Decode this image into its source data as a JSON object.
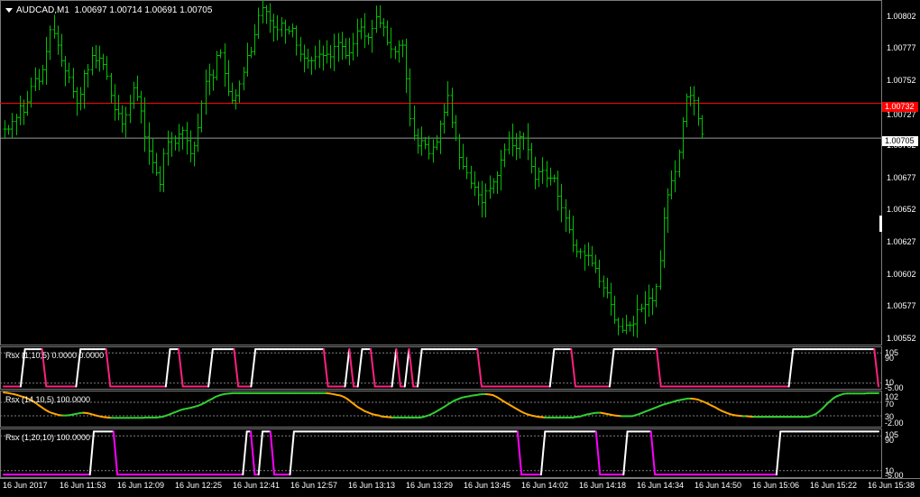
{
  "header": {
    "symbol_label": "AUDCAD,M1",
    "ohlc_label": "1.00697 1.00714 1.00691 1.00705"
  },
  "price_scale": {
    "ticks": [
      "1.00802",
      "1.00777",
      "1.00752",
      "1.00727",
      "1.00702",
      "1.00677",
      "1.00652",
      "1.00627",
      "1.00602",
      "1.00577",
      "1.00552"
    ],
    "red_line_label": "1.00732",
    "current_price_label": "1.00705"
  },
  "indicators": [
    {
      "title": "Rsx (1,10,5) 0.0000 0.0000",
      "axis_labels": [
        "105",
        "90",
        "10",
        "-5.00"
      ]
    },
    {
      "title": "Rsx (14,10,5) 100.0000",
      "axis_labels": [
        "102",
        "70",
        "30",
        "-2.00"
      ]
    },
    {
      "title": "Rsx (1,20,10) 100.0000",
      "axis_labels": [
        "105",
        "90",
        "10",
        "-5.00"
      ]
    }
  ],
  "time_axis": {
    "labels": [
      "16 Jun 2017",
      "16 Jun 11:53",
      "16 Jun 12:09",
      "16 Jun 12:25",
      "16 Jun 12:41",
      "16 Jun 12:57",
      "16 Jun 13:13",
      "16 Jun 13:29",
      "16 Jun 13:45",
      "16 Jun 14:02",
      "16 Jun 14:18",
      "16 Jun 14:34",
      "16 Jun 14:50",
      "16 Jun 15:06",
      "16 Jun 15:22",
      "16 Jun 15:38"
    ]
  },
  "colors": {
    "background": "#000000",
    "bars": "#00c000",
    "red_level": "#ff0000",
    "rsx_high": "#ffffff",
    "rsx_falling_1": "#ff2080",
    "rsx_rising_2": "#32cd32",
    "rsx_falling_2": "#ffa500",
    "rsx_falling_3": "#ff00ff",
    "grid": "#808080"
  },
  "chart_data": [
    {
      "type": "ohlc",
      "title": "AUDCAD,M1",
      "ylim": [
        1.00545,
        1.00812
      ],
      "red_level": 1.00732,
      "current_price": 1.00705,
      "closes": [
        1.00712,
        1.00712,
        1.00718,
        1.00721,
        1.0073,
        1.00725,
        1.00733,
        1.00745,
        1.00751,
        1.00749,
        1.00758,
        1.00772,
        1.00789,
        1.00786,
        1.00777,
        1.00765,
        1.00757,
        1.00752,
        1.00741,
        1.00732,
        1.00739,
        1.00755,
        1.00758,
        1.00769,
        1.00765,
        1.00767,
        1.00762,
        1.00753,
        1.00738,
        1.00727,
        1.00724,
        1.00716,
        1.00723,
        1.00732,
        1.00744,
        1.00737,
        1.00726,
        1.00706,
        1.00695,
        1.00686,
        1.00678,
        1.00669,
        1.00693,
        1.00702,
        1.00705,
        1.00701,
        1.00708,
        1.00711,
        1.00703,
        1.00693,
        1.00699,
        1.00713,
        1.00732,
        1.00749,
        1.00754,
        1.00752,
        1.00769,
        1.00771,
        1.00755,
        1.00741,
        1.00734,
        1.00738,
        1.00747,
        1.00756,
        1.00769,
        1.00772,
        1.00785,
        1.008,
        1.00806,
        1.00803,
        1.00796,
        1.00791,
        1.00789,
        1.00794,
        1.00789,
        1.00788,
        1.0079,
        1.00777,
        1.0077,
        1.00767,
        1.00765,
        1.00765,
        1.00768,
        1.0077,
        1.00769,
        1.0077,
        1.00768,
        1.00776,
        1.00779,
        1.00776,
        1.00769,
        1.00771,
        1.00778,
        1.00788,
        1.00791,
        1.00784,
        1.00783,
        1.0079,
        1.00799,
        1.00794,
        1.00791,
        1.00779,
        1.00774,
        1.00772,
        1.00777,
        1.00777,
        1.00751,
        1.0072,
        1.00707,
        1.00699,
        1.00703,
        1.007,
        1.00693,
        1.00698,
        1.00702,
        1.00716,
        1.00725,
        1.00738,
        1.00717,
        1.00705,
        1.0069,
        1.00683,
        1.00678,
        1.0067,
        1.00667,
        1.00661,
        1.00655,
        1.00664,
        1.00666,
        1.00671,
        1.00676,
        1.00688,
        1.00696,
        1.00705,
        1.00699,
        1.00697,
        1.00706,
        1.00705,
        1.00696,
        1.00683,
        1.00673,
        1.00679,
        1.0068,
        1.00674,
        1.00674,
        1.00674,
        1.0066,
        1.00651,
        1.00643,
        1.00634,
        1.00622,
        1.00617,
        1.00617,
        1.00614,
        1.00614,
        1.00608,
        1.00604,
        1.00594,
        1.00589,
        1.00585,
        1.00576,
        1.00564,
        1.00559,
        1.00556,
        1.0056,
        1.0056,
        1.00561,
        1.00572,
        1.00573,
        1.00576,
        1.00581,
        1.00579,
        1.0059,
        1.0061,
        1.00643,
        1.00661,
        1.00672,
        1.00679,
        1.00694,
        1.00718,
        1.00737,
        1.00738,
        1.00734,
        1.0072,
        1.00708
      ]
    },
    {
      "type": "line",
      "title": "Rsx (1,10,5)",
      "ylim": [
        -5,
        105
      ],
      "levels": [
        90,
        10
      ],
      "values": [
        1,
        1,
        1,
        1,
        1,
        100,
        100,
        100,
        100,
        100,
        1,
        1,
        1,
        1,
        1,
        1,
        1,
        1,
        100,
        100,
        100,
        100,
        100,
        100,
        100,
        1,
        1,
        1,
        1,
        1,
        1,
        1,
        1,
        1,
        1,
        1,
        1,
        1,
        1,
        100,
        100,
        100,
        1,
        1,
        1,
        1,
        1,
        1,
        1,
        100,
        100,
        100,
        100,
        100,
        100,
        1,
        1,
        1,
        1,
        100,
        100,
        100,
        100,
        100,
        100,
        100,
        100,
        100,
        100,
        100,
        100,
        100,
        100,
        100,
        100,
        100,
        1,
        1,
        1,
        1,
        1,
        100,
        1,
        1,
        100,
        100,
        100,
        1,
        1,
        1,
        1,
        1,
        100,
        1,
        1,
        100,
        1,
        1,
        100,
        100,
        100,
        100,
        100,
        100,
        100,
        100,
        100,
        100,
        100,
        100,
        100,
        100,
        1,
        1,
        1,
        1,
        1,
        1,
        1,
        1,
        1,
        1,
        1,
        1,
        1,
        1,
        1,
        1,
        1,
        100,
        100,
        100,
        100,
        100,
        1,
        1,
        1,
        1,
        1,
        1,
        1,
        1,
        1,
        100,
        100,
        100,
        100,
        100,
        100,
        100,
        100,
        100,
        100,
        100,
        1,
        1,
        1,
        1,
        1,
        1,
        1,
        1,
        1,
        1,
        1,
        1,
        1,
        1,
        1,
        1,
        1,
        1,
        1,
        1,
        1,
        1,
        1,
        1,
        1,
        1,
        1,
        1,
        1,
        1,
        1,
        100,
        100,
        100,
        100,
        100,
        100,
        100,
        100,
        100,
        100,
        100,
        100,
        100,
        100,
        100,
        100,
        100,
        100,
        100,
        100,
        1
      ]
    },
    {
      "type": "line",
      "title": "Rsx (14,10,5)",
      "ylim": [
        -2,
        102
      ],
      "levels": [
        70,
        30
      ],
      "values": [
        99,
        98,
        96,
        94,
        91,
        88,
        85,
        81,
        76,
        70,
        62,
        55,
        48,
        42,
        38,
        35,
        32,
        31,
        31,
        32,
        34,
        36,
        38,
        39,
        38,
        36,
        33,
        30,
        28,
        26,
        25,
        24,
        24,
        24,
        24,
        24,
        24,
        24,
        24,
        24,
        24,
        25,
        25,
        25,
        25,
        26,
        28,
        31,
        35,
        39,
        43,
        47,
        50,
        52,
        54,
        57,
        60,
        64,
        69,
        75,
        80,
        86,
        90,
        93,
        95,
        96,
        97,
        97,
        97,
        97,
        97,
        97,
        97,
        97,
        97,
        97,
        97,
        97,
        97,
        97,
        97,
        97,
        97,
        97,
        97,
        97,
        97,
        97,
        97,
        97,
        97,
        97,
        97,
        97,
        96,
        94,
        92,
        90,
        86,
        80,
        72,
        64,
        56,
        50,
        44,
        40,
        36,
        33,
        31,
        28,
        27,
        26,
        25,
        25,
        25,
        25,
        25,
        25,
        25,
        25,
        25,
        27,
        30,
        34,
        39,
        45,
        51,
        57,
        64,
        70,
        76,
        80,
        84,
        86,
        88,
        90,
        91,
        93,
        94,
        94,
        93,
        91,
        86,
        80,
        73,
        67,
        61,
        55,
        49,
        43,
        38,
        34,
        31,
        29,
        27,
        26,
        25,
        25,
        25,
        25,
        25,
        25,
        25,
        25,
        25,
        27,
        28,
        31,
        34,
        36,
        38,
        39,
        39,
        37,
        35,
        33,
        31,
        30,
        29,
        29,
        29,
        29,
        32,
        35,
        39,
        43,
        47,
        51,
        55,
        59,
        63,
        66,
        69,
        72,
        75,
        77,
        79,
        81,
        81,
        80,
        78,
        74,
        70,
        65,
        60,
        55,
        49,
        44,
        40,
        36,
        33,
        31,
        30,
        29,
        29,
        28,
        27,
        27,
        27,
        27,
        27,
        27,
        27,
        27,
        27,
        27,
        27,
        27,
        27,
        27,
        27,
        27,
        28,
        31,
        36,
        44,
        53,
        64,
        73,
        82,
        88,
        92,
        95,
        96,
        96,
        96,
        96,
        96,
        96,
        97,
        97,
        97,
        97
      ]
    },
    {
      "type": "line",
      "title": "Rsx (1,20,10)",
      "ylim": [
        -5,
        105
      ],
      "levels": [
        90,
        10
      ],
      "values": [
        1,
        1,
        1,
        1,
        1,
        1,
        1,
        1,
        1,
        1,
        1,
        1,
        1,
        1,
        1,
        1,
        1,
        1,
        1,
        1,
        1,
        1,
        1,
        100,
        100,
        100,
        100,
        100,
        100,
        1,
        1,
        1,
        1,
        1,
        1,
        1,
        1,
        1,
        1,
        1,
        1,
        1,
        1,
        1,
        1,
        1,
        1,
        1,
        1,
        1,
        1,
        1,
        1,
        1,
        1,
        1,
        1,
        1,
        1,
        1,
        1,
        1,
        100,
        100,
        1,
        1,
        100,
        100,
        100,
        1,
        1,
        1,
        1,
        1,
        100,
        100,
        100,
        100,
        100,
        100,
        100,
        100,
        100,
        100,
        100,
        100,
        100,
        100,
        100,
        100,
        100,
        100,
        100,
        100,
        100,
        100,
        100,
        100,
        100,
        100,
        100,
        100,
        100,
        100,
        100,
        100,
        100,
        100,
        100,
        100,
        100,
        100,
        100,
        100,
        100,
        100,
        100,
        100,
        100,
        100,
        100,
        100,
        100,
        100,
        100,
        100,
        100,
        100,
        100,
        100,
        100,
        100,
        1,
        1,
        1,
        1,
        1,
        1,
        100,
        100,
        100,
        100,
        100,
        100,
        100,
        100,
        100,
        100,
        100,
        100,
        100,
        100,
        1,
        1,
        1,
        1,
        1,
        1,
        1,
        100,
        100,
        100,
        100,
        100,
        100,
        100,
        1,
        1,
        1,
        1,
        1,
        1,
        1,
        1,
        1,
        1,
        1,
        1,
        1,
        1,
        1,
        1,
        1,
        1,
        1,
        1,
        1,
        1,
        1,
        1,
        1,
        1,
        1,
        1,
        1,
        1,
        1,
        1,
        100,
        100,
        100,
        100,
        100,
        100,
        100,
        100,
        100,
        100,
        100,
        100,
        100,
        100,
        100,
        100,
        100,
        100,
        100,
        100,
        100,
        100,
        100,
        100,
        100,
        100
      ]
    }
  ]
}
